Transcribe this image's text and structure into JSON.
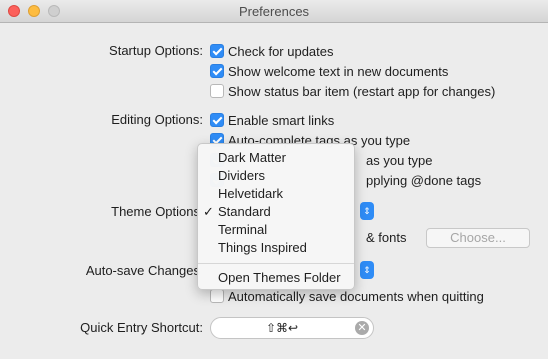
{
  "window": {
    "title": "Preferences"
  },
  "startup": {
    "label": "Startup Options:",
    "items": [
      {
        "label": "Check for updates",
        "checked": true
      },
      {
        "label": "Show welcome text in new documents",
        "checked": true
      },
      {
        "label": "Show status bar item (restart app for changes)",
        "checked": false
      }
    ]
  },
  "editing": {
    "label": "Editing Options:",
    "items": [
      {
        "label": "Enable smart links",
        "checked": true
      },
      {
        "label": "Auto-complete tags as you type",
        "checked": true
      },
      {
        "label": "as you type",
        "checked": true
      },
      {
        "label": "pplying @done tags",
        "checked": true
      }
    ]
  },
  "theme": {
    "label": "Theme Options",
    "fonts_text": "& fonts",
    "choose_button": "Choose...",
    "menu": {
      "items": [
        {
          "label": "Dark Matter",
          "selected": false
        },
        {
          "label": "Dividers",
          "selected": false
        },
        {
          "label": "Helvetidark",
          "selected": false
        },
        {
          "label": "Standard",
          "selected": true
        },
        {
          "label": "Terminal",
          "selected": false
        },
        {
          "label": "Things Inspired",
          "selected": false
        }
      ],
      "open_folder": "Open Themes Folder",
      "check_glyph": "✓"
    }
  },
  "autosave": {
    "label": "Auto-save Changes",
    "quit_item": {
      "label": "Automatically save documents when quitting",
      "checked": false
    }
  },
  "quick_entry": {
    "label": "Quick Entry Shortcut:",
    "keys": "⇧⌘↩",
    "clear_icon": "✕"
  },
  "colors": {
    "accent": "#2f8cf6"
  }
}
